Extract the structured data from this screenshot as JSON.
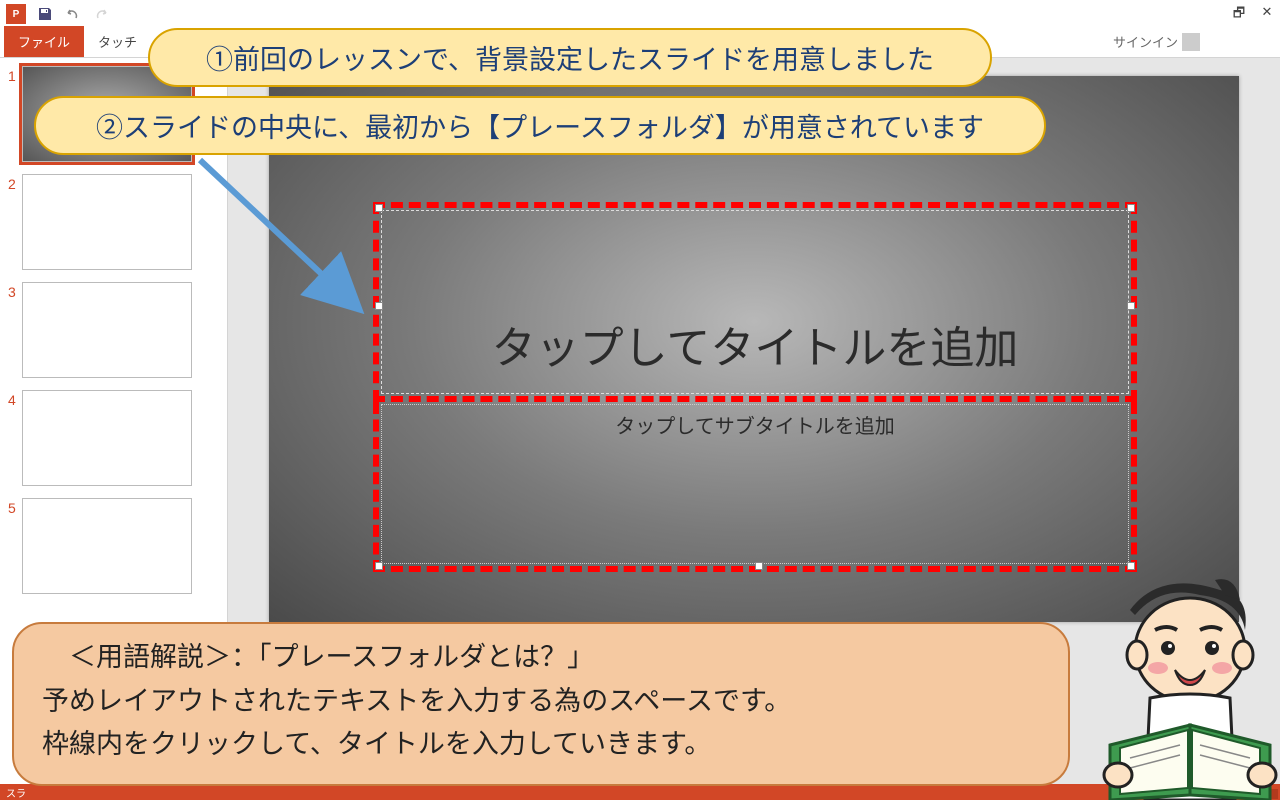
{
  "titlebar": {
    "app_label": "P"
  },
  "ribbon": {
    "file": "ファイル",
    "touch": "タッチ",
    "signin": "サインイン"
  },
  "thumbs": {
    "count": 5
  },
  "slide": {
    "title_placeholder": "タップしてタイトルを追加",
    "subtitle_placeholder": "タップしてサブタイトルを追加"
  },
  "callouts": {
    "c1": "①前回のレッスンで、背景設定したスライドを用意しました",
    "c2": "②スライドの中央に、最初から【プレースフォルダ】が用意されています"
  },
  "explain": {
    "l1": "　＜用語解説＞：「プレースフォルダとは？」",
    "l2": "予めレイアウトされたテキストを入力する為のスペースです。",
    "l3": "枠線内をクリックして、タイトルを入力していきます。"
  },
  "status": "スラ"
}
